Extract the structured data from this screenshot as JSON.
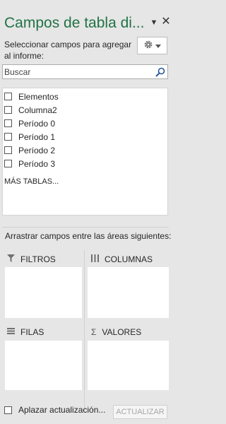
{
  "panel": {
    "title": "Campos de tabla di...",
    "subtitle": "Seleccionar campos para agregar al informe:"
  },
  "search": {
    "placeholder": "Buscar"
  },
  "fields": [
    {
      "label": "Elementos",
      "checked": false
    },
    {
      "label": "Columna2",
      "checked": false
    },
    {
      "label": "Período 0",
      "checked": false
    },
    {
      "label": "Período 1",
      "checked": false
    },
    {
      "label": "Período 2",
      "checked": false
    },
    {
      "label": "Período 3",
      "checked": false
    }
  ],
  "more_tables": "MÁS TABLAS...",
  "drag_hint": "Arrastrar campos entre las áreas siguientes:",
  "areas": {
    "filters": "FILTROS",
    "columns": "COLUMNAS",
    "rows": "FILAS",
    "values": "VALORES"
  },
  "footer": {
    "defer_label": "Aplazar actualización...",
    "update_label": "ACTUALIZAR"
  },
  "colors": {
    "title": "#217346",
    "background": "#e6e6e6"
  },
  "icons": [
    "chevron-down-icon",
    "close-icon",
    "gear-icon",
    "search-icon",
    "filter-icon",
    "columns-icon",
    "rows-icon",
    "sigma-icon"
  ]
}
